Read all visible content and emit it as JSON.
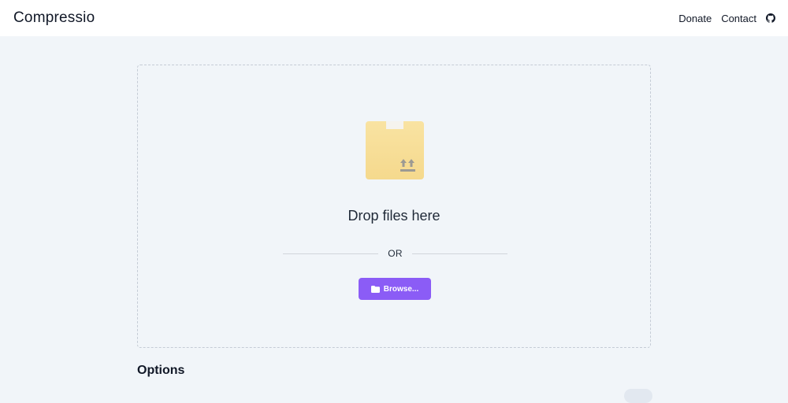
{
  "header": {
    "brand": "Compressio",
    "nav": [
      {
        "label": "Donate"
      },
      {
        "label": "Contact"
      }
    ],
    "github_icon": "github-icon"
  },
  "dropzone": {
    "icon": "box-upload-icon",
    "title": "Drop files here",
    "separator": "OR",
    "browse_label": "Browse...",
    "browse_icon": "folder-icon"
  },
  "options": {
    "title": "Options"
  },
  "colors": {
    "accent": "#8b5cf6",
    "background": "#f1f5f9",
    "box": "#f7df98"
  }
}
